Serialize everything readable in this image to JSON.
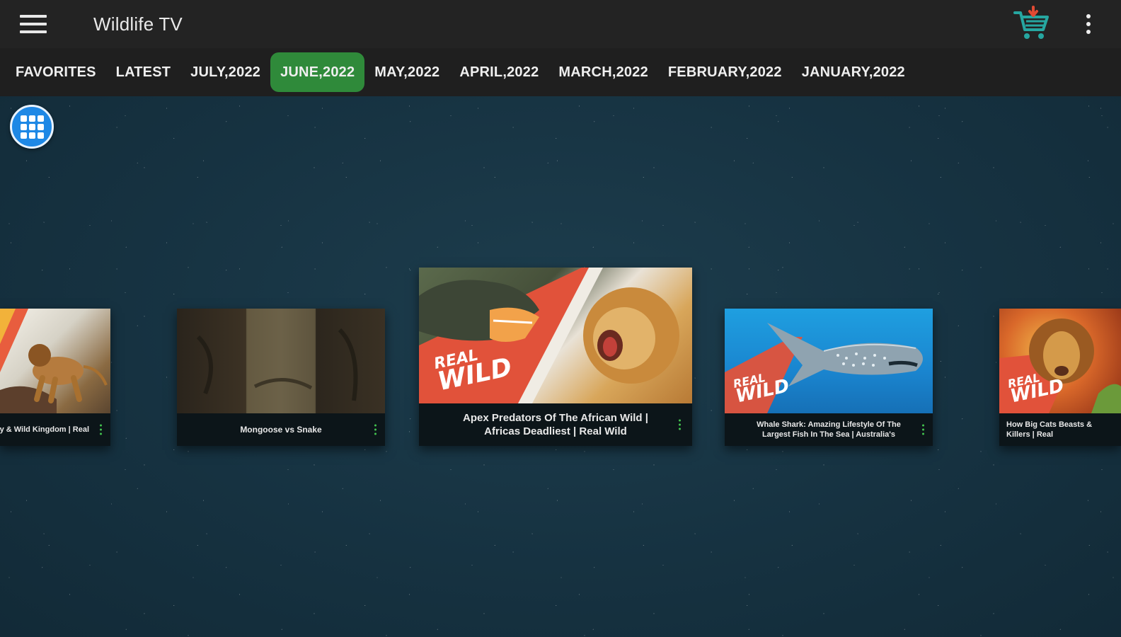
{
  "appbar": {
    "title": "Wildlife TV",
    "icons": {
      "menu": "hamburger-menu-icon",
      "cart": "download-cart-icon",
      "more": "more-vertical-icon"
    },
    "cart_color": "#26a6a0",
    "cart_arrow_color": "#e24a33"
  },
  "tabs": [
    {
      "label": "FAVORITES",
      "active": false
    },
    {
      "label": "LATEST",
      "active": false
    },
    {
      "label": "JULY,2022",
      "active": false
    },
    {
      "label": "JUNE,2022",
      "active": true
    },
    {
      "label": "MAY,2022",
      "active": false
    },
    {
      "label": "APRIL,2022",
      "active": false
    },
    {
      "label": "MARCH,2022",
      "active": false
    },
    {
      "label": "FEBRUARY,2022",
      "active": false
    },
    {
      "label": "JANUARY,2022",
      "active": false
    }
  ],
  "accent_color": "#2f8a3a",
  "grid_button": {
    "icon": "grid-view-icon",
    "color": "#1e88e5"
  },
  "logo_text": {
    "line1": "REAL",
    "line2": "WILD"
  },
  "videos": [
    {
      "title": "Predators Prey & Wild Kingdom | Real",
      "duration": ""
    },
    {
      "title": "Mongoose vs Snake",
      "duration": ""
    },
    {
      "title": "Apex Predators Of The African Wild | Africas Deadliest | Real Wild",
      "duration": ""
    },
    {
      "title": "Whale Shark: Amazing Lifestyle Of The Largest Fish In The Sea | Australia's",
      "duration": ""
    },
    {
      "title": "How Big Cats Beasts & Killers | Real",
      "duration": ""
    }
  ]
}
